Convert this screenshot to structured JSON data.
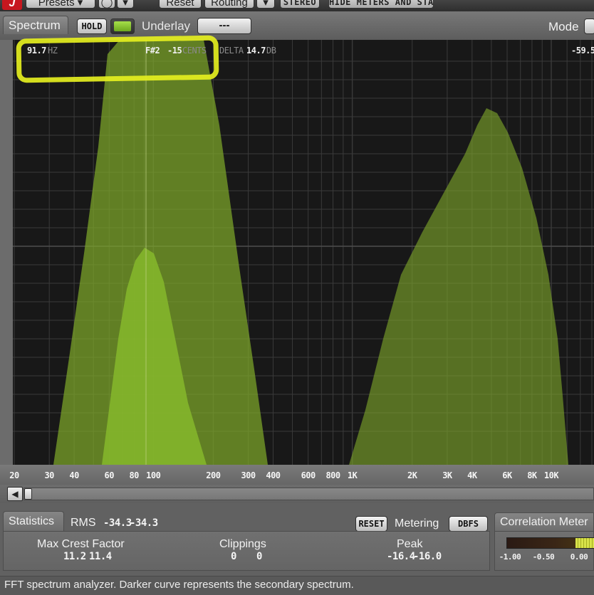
{
  "toolbar": {
    "logo": "J",
    "presets_label": "Presets",
    "reset_label": "Reset",
    "routing_label": "Routing",
    "stereo_label": "STEREO",
    "hide_meters_label": "HIDE METERS AND STATS"
  },
  "spectrum": {
    "tab_label": "Spectrum",
    "hold_label": "HOLD",
    "underlay_label": "Underlay",
    "underlay_value": "---",
    "mode_label": "Mode",
    "readout": {
      "freq_value": "91.7",
      "freq_unit": "HZ",
      "note": "F#2",
      "cents_value": "-15",
      "cents_unit": "CENTS",
      "delta_label": "DELTA",
      "delta_value": "14.7",
      "delta_unit": "DB",
      "level_right": "-59.5"
    },
    "x_axis_ticks": [
      {
        "label": "20",
        "hz": 20
      },
      {
        "label": "30",
        "hz": 30
      },
      {
        "label": "40",
        "hz": 40
      },
      {
        "label": "60",
        "hz": 60
      },
      {
        "label": "80",
        "hz": 80
      },
      {
        "label": "100",
        "hz": 100
      },
      {
        "label": "200",
        "hz": 200
      },
      {
        "label": "300",
        "hz": 300
      },
      {
        "label": "400",
        "hz": 400
      },
      {
        "label": "600",
        "hz": 600
      },
      {
        "label": "800",
        "hz": 800
      },
      {
        "label": "1K",
        "hz": 1000
      },
      {
        "label": "2K",
        "hz": 2000
      },
      {
        "label": "3K",
        "hz": 3000
      },
      {
        "label": "4K",
        "hz": 4000
      },
      {
        "label": "6K",
        "hz": 6000
      },
      {
        "label": "8K",
        "hz": 8000
      },
      {
        "label": "10K",
        "hz": 10000
      }
    ],
    "colors": {
      "primary_curve": "#7ea72a",
      "secondary_curve": "#5e7f1f",
      "grid": "#3a3a3a",
      "highlight": "#e5ef1f"
    }
  },
  "statistics": {
    "tab_label": "Statistics",
    "rms_label": "RMS",
    "rms_left": "-34.3",
    "rms_right": "-34.3",
    "reset_label": "RESET",
    "metering_label": "Metering",
    "metering_mode": "DBFS",
    "max_crest_label": "Max Crest Factor",
    "max_crest_left": "11.2",
    "max_crest_right": "11.4",
    "clippings_label": "Clippings",
    "clippings_left": "0",
    "clippings_right": "0",
    "peak_label": "Peak",
    "peak_left": "-16.4",
    "peak_right": "-16.0"
  },
  "correlation": {
    "tab_label": "Correlation Meter",
    "scale": [
      "-1.00",
      "-0.50",
      "0.00"
    ]
  },
  "footer": {
    "description": "FFT spectrum analyzer. Darker curve represents the secondary spectrum."
  }
}
